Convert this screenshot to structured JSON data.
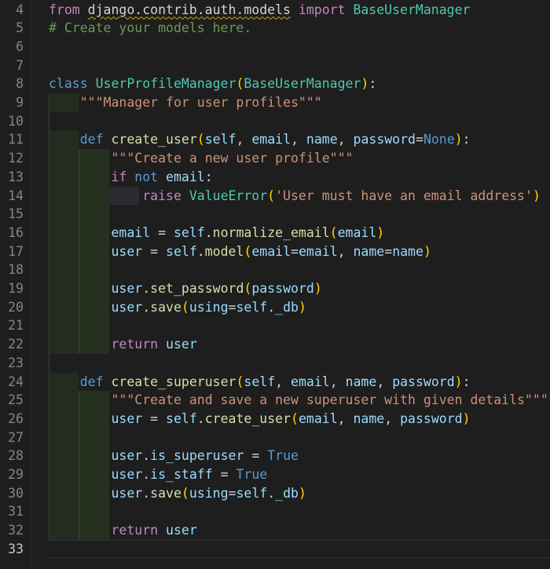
{
  "editor": {
    "language": "python",
    "active_line": "33",
    "colors": {
      "background": "#1e1e1e",
      "keyword": "#569cd6",
      "control_keyword": "#c586c0",
      "class_name": "#4ec9b0",
      "function": "#dcdcaa",
      "variable": "#9cdcfe",
      "string": "#ce9178",
      "comment": "#6a9955",
      "bracket_level_1": "#ffd700",
      "bracket_level_2": "#da70d6",
      "warning_squiggle": "#cca700"
    },
    "lines": [
      {
        "n": "4",
        "tokens": [
          [
            "kw",
            "from "
          ],
          [
            "sq",
            "django.contrib.auth.models"
          ],
          [
            "kw",
            " import "
          ],
          [
            "cls",
            "BaseUserManager"
          ]
        ]
      },
      {
        "n": "5",
        "tokens": [
          [
            "cmt",
            "# Create your models here."
          ]
        ]
      },
      {
        "n": "6",
        "tokens": []
      },
      {
        "n": "7",
        "tokens": []
      },
      {
        "n": "8",
        "tokens": [
          [
            "kw-blue",
            "class "
          ],
          [
            "cls",
            "UserProfileManager"
          ],
          [
            "p1",
            "("
          ],
          [
            "cls",
            "BaseUserManager"
          ],
          [
            "p1",
            ")"
          ],
          [
            "pun",
            ":"
          ]
        ]
      },
      {
        "n": "9",
        "tokens": [
          [
            "pun",
            "    "
          ],
          [
            "str",
            "\"\"\"Manager for user profiles\"\"\""
          ]
        ]
      },
      {
        "n": "10",
        "tokens": []
      },
      {
        "n": "11",
        "tokens": [
          [
            "pun",
            "    "
          ],
          [
            "kw-blue",
            "def "
          ],
          [
            "fn",
            "create_user"
          ],
          [
            "p1",
            "("
          ],
          [
            "var",
            "self"
          ],
          [
            "pun",
            ", "
          ],
          [
            "var",
            "email"
          ],
          [
            "pun",
            ", "
          ],
          [
            "var",
            "name"
          ],
          [
            "pun",
            ", "
          ],
          [
            "var",
            "password"
          ],
          [
            "pun",
            "="
          ],
          [
            "kw-blue",
            "None"
          ],
          [
            "p1",
            ")"
          ],
          [
            "pun",
            ":"
          ]
        ]
      },
      {
        "n": "12",
        "tokens": [
          [
            "pun",
            "        "
          ],
          [
            "str",
            "\"\"\"Create a new user profile\"\"\""
          ]
        ]
      },
      {
        "n": "13",
        "tokens": [
          [
            "pun",
            "        "
          ],
          [
            "kw",
            "if "
          ],
          [
            "kw-blue",
            "not "
          ],
          [
            "var",
            "email"
          ],
          [
            "pun",
            ":"
          ]
        ]
      },
      {
        "n": "14",
        "tokens": [
          [
            "pun",
            "            "
          ],
          [
            "kw",
            "raise "
          ],
          [
            "cls",
            "ValueError"
          ],
          [
            "p1",
            "("
          ],
          [
            "str",
            "'User must have an email address'"
          ],
          [
            "p1",
            ")"
          ]
        ]
      },
      {
        "n": "15",
        "tokens": []
      },
      {
        "n": "16",
        "tokens": [
          [
            "pun",
            "        "
          ],
          [
            "var",
            "email"
          ],
          [
            "pun",
            " = "
          ],
          [
            "var",
            "self"
          ],
          [
            "pun",
            "."
          ],
          [
            "fn",
            "normalize_email"
          ],
          [
            "p1",
            "("
          ],
          [
            "var",
            "email"
          ],
          [
            "p1",
            ")"
          ]
        ]
      },
      {
        "n": "17",
        "tokens": [
          [
            "pun",
            "        "
          ],
          [
            "var",
            "user"
          ],
          [
            "pun",
            " = "
          ],
          [
            "var",
            "self"
          ],
          [
            "pun",
            "."
          ],
          [
            "fn",
            "model"
          ],
          [
            "p1",
            "("
          ],
          [
            "var",
            "email"
          ],
          [
            "pun",
            "="
          ],
          [
            "var",
            "email"
          ],
          [
            "pun",
            ", "
          ],
          [
            "var",
            "name"
          ],
          [
            "pun",
            "="
          ],
          [
            "var",
            "name"
          ],
          [
            "p1",
            ")"
          ]
        ]
      },
      {
        "n": "18",
        "tokens": []
      },
      {
        "n": "19",
        "tokens": [
          [
            "pun",
            "        "
          ],
          [
            "var",
            "user"
          ],
          [
            "pun",
            "."
          ],
          [
            "fn",
            "set_password"
          ],
          [
            "p1",
            "("
          ],
          [
            "var",
            "password"
          ],
          [
            "p1",
            ")"
          ]
        ]
      },
      {
        "n": "20",
        "tokens": [
          [
            "pun",
            "        "
          ],
          [
            "var",
            "user"
          ],
          [
            "pun",
            "."
          ],
          [
            "fn",
            "save"
          ],
          [
            "p1",
            "("
          ],
          [
            "var",
            "using"
          ],
          [
            "pun",
            "="
          ],
          [
            "var",
            "self"
          ],
          [
            "pun",
            "."
          ],
          [
            "var",
            "_db"
          ],
          [
            "p1",
            ")"
          ]
        ]
      },
      {
        "n": "21",
        "tokens": []
      },
      {
        "n": "22",
        "tokens": [
          [
            "pun",
            "        "
          ],
          [
            "kw",
            "return "
          ],
          [
            "var",
            "user"
          ]
        ]
      },
      {
        "n": "23",
        "tokens": []
      },
      {
        "n": "24",
        "tokens": [
          [
            "pun",
            "    "
          ],
          [
            "kw-blue",
            "def "
          ],
          [
            "fn",
            "create_superuser"
          ],
          [
            "p1",
            "("
          ],
          [
            "var",
            "self"
          ],
          [
            "pun",
            ", "
          ],
          [
            "var",
            "email"
          ],
          [
            "pun",
            ", "
          ],
          [
            "var",
            "name"
          ],
          [
            "pun",
            ", "
          ],
          [
            "var",
            "password"
          ],
          [
            "p1",
            ")"
          ],
          [
            "pun",
            ":"
          ]
        ]
      },
      {
        "n": "25",
        "tokens": [
          [
            "pun",
            "        "
          ],
          [
            "str",
            "\"\"\"Create and save a new superuser with given details\"\"\""
          ]
        ]
      },
      {
        "n": "26",
        "tokens": [
          [
            "pun",
            "        "
          ],
          [
            "var",
            "user"
          ],
          [
            "pun",
            " = "
          ],
          [
            "var",
            "self"
          ],
          [
            "pun",
            "."
          ],
          [
            "fn",
            "create_user"
          ],
          [
            "p1",
            "("
          ],
          [
            "var",
            "email"
          ],
          [
            "pun",
            ", "
          ],
          [
            "var",
            "name"
          ],
          [
            "pun",
            ", "
          ],
          [
            "var",
            "password"
          ],
          [
            "p1",
            ")"
          ]
        ]
      },
      {
        "n": "27",
        "tokens": []
      },
      {
        "n": "28",
        "tokens": [
          [
            "pun",
            "        "
          ],
          [
            "var",
            "user"
          ],
          [
            "pun",
            "."
          ],
          [
            "var",
            "is_superuser"
          ],
          [
            "pun",
            " = "
          ],
          [
            "kw-blue",
            "True"
          ]
        ]
      },
      {
        "n": "29",
        "tokens": [
          [
            "pun",
            "        "
          ],
          [
            "var",
            "user"
          ],
          [
            "pun",
            "."
          ],
          [
            "var",
            "is_staff"
          ],
          [
            "pun",
            " = "
          ],
          [
            "kw-blue",
            "True"
          ]
        ]
      },
      {
        "n": "30",
        "tokens": [
          [
            "pun",
            "        "
          ],
          [
            "var",
            "user"
          ],
          [
            "pun",
            "."
          ],
          [
            "fn",
            "save"
          ],
          [
            "p1",
            "("
          ],
          [
            "var",
            "using"
          ],
          [
            "pun",
            "="
          ],
          [
            "var",
            "self"
          ],
          [
            "pun",
            "."
          ],
          [
            "var",
            "_db"
          ],
          [
            "p1",
            ")"
          ]
        ]
      },
      {
        "n": "31",
        "tokens": []
      },
      {
        "n": "32",
        "tokens": [
          [
            "pun",
            "        "
          ],
          [
            "kw",
            "return "
          ],
          [
            "var",
            "user"
          ]
        ]
      },
      {
        "n": "33",
        "tokens": []
      }
    ]
  }
}
